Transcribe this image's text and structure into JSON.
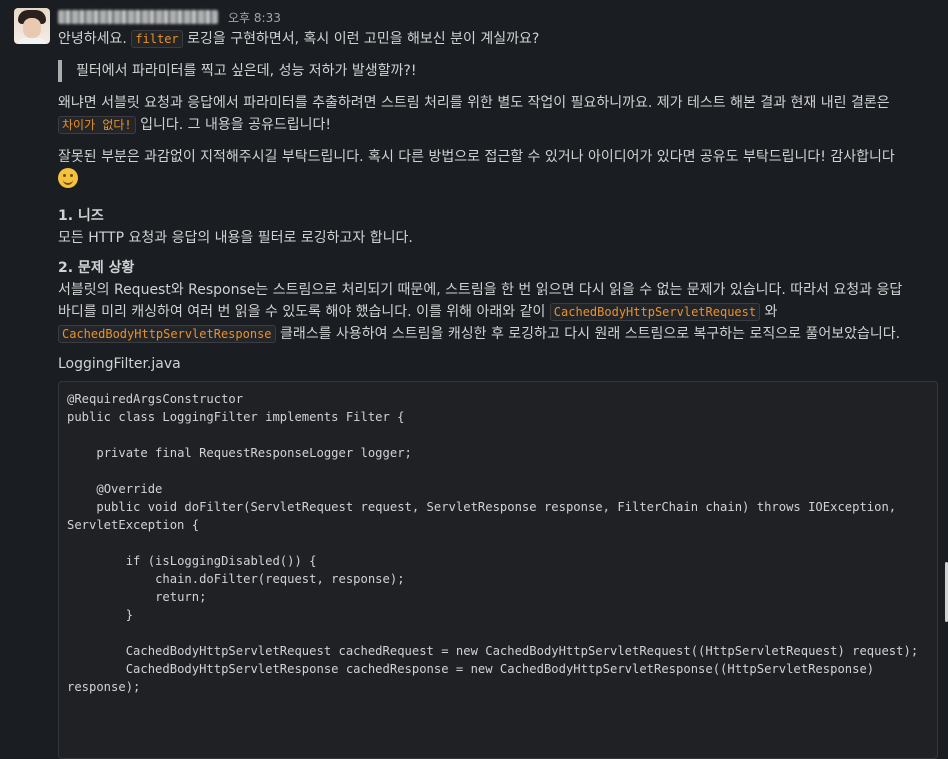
{
  "message": {
    "time": "오후 8:33",
    "line1_pre": "안녕하세요.",
    "line1_code": "filter",
    "line1_post": "로깅을 구현하면서, 혹시 이런 고민을 해보신 분이 계실까요?",
    "quote": "필터에서 파라미터를 찍고 싶은데, 성능 저하가 발생할까?!",
    "para2_line1": "왜냐면 서블릿 요청과 응답에서 파라미터를 추출하려면 스트림 처리를 위한 별도 작업이 필요하니까요. 제가 테스트 해본 결과 현재 내린 결론은",
    "para2_code": "차이가 없다!",
    "para2_post": "입니다. 그 내용을 공유드립니다!",
    "para3": "잘못된 부분은 과감없이 지적해주시길 부탁드립니다. 혹시 다른 방법으로 접근할 수 있거나 아이디어가 있다면 공유도 부탁드립니다! 감사합니다",
    "section1_title": "1. 니즈",
    "section1_body": "모든 HTTP 요청과 응답의 내용을 필터로 로깅하고자 합니다.",
    "section2_title": "2. 문제 상황",
    "section2_line1": "서블릿의 Request와 Response는 스트림으로 처리되기 때문에, 스트림을 한 번 읽으면 다시 읽을 수 없는 문제가 있습니다. 따라서 요청과 응답",
    "section2_line2_pre": "바디를 미리 캐싱하여 여러 번 읽을 수 있도록 해야 했습니다. 이를 위해 아래와 같이",
    "section2_code1": "CachedBodyHttpServletRequest",
    "section2_line2_post": "와",
    "section2_code2": "CachedBodyHttpServletResponse",
    "section2_line3_post": "클래스를 사용하여 스트림을 캐싱한 후 로깅하고 다시 원래 스트림으로 복구하는 로직으로 풀어보았습니다.",
    "filename": "LoggingFilter.java",
    "code": "@RequiredArgsConstructor\npublic class LoggingFilter implements Filter {\n\n    private final RequestResponseLogger logger;\n\n    @Override\n    public void doFilter(ServletRequest request, ServletResponse response, FilterChain chain) throws IOException,\nServletException {\n\n        if (isLoggingDisabled()) {\n            chain.doFilter(request, response);\n            return;\n        }\n\n        CachedBodyHttpServletRequest cachedRequest = new CachedBodyHttpServletRequest((HttpServletRequest) request);\n        CachedBodyHttpServletResponse cachedResponse = new CachedBodyHttpServletResponse((HttpServletResponse)\nresponse);"
  },
  "icons": {
    "emoji": "slightly-smiling-face-icon"
  },
  "colors": {
    "background": "#1a1d21",
    "text": "#d1d2d3",
    "inline_code": "#e8912d"
  }
}
